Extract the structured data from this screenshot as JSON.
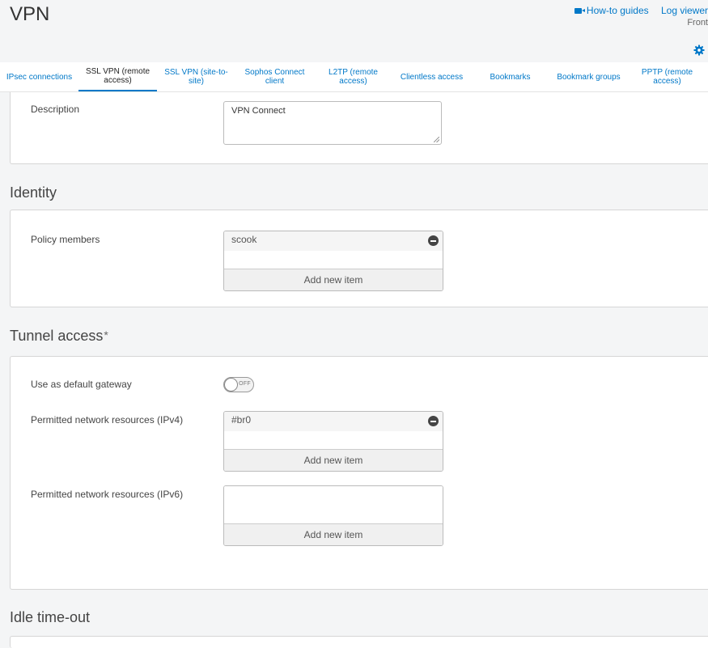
{
  "page": {
    "title": "VPN"
  },
  "header": {
    "howto_label": "How-to guides",
    "logviewer_label": "Log viewer",
    "sub_label": "Front"
  },
  "tabs": [
    {
      "label": "IPsec connections",
      "active": false
    },
    {
      "label": "SSL VPN (remote access)",
      "active": true
    },
    {
      "label": "SSL VPN (site-to-site)",
      "active": false
    },
    {
      "label": "Sophos Connect client",
      "active": false
    },
    {
      "label": "L2TP (remote access)",
      "active": false
    },
    {
      "label": "Clientless access",
      "active": false
    },
    {
      "label": "Bookmarks",
      "active": false
    },
    {
      "label": "Bookmark groups",
      "active": false
    },
    {
      "label": "PPTP (remote access)",
      "active": false
    }
  ],
  "general": {
    "description_label": "Description",
    "description_value": "VPN Connect"
  },
  "identity": {
    "title": "Identity",
    "policy_members_label": "Policy members",
    "policy_members": [
      "scook"
    ],
    "add_label": "Add new item"
  },
  "tunnel": {
    "title": "Tunnel access",
    "required_mark": "*",
    "default_gateway_label": "Use as default gateway",
    "default_gateway_state": "OFF",
    "ipv4_label": "Permitted network resources (IPv4)",
    "ipv4_items": [
      "#br0"
    ],
    "ipv6_label": "Permitted network resources (IPv6)",
    "ipv6_items": [],
    "add_label": "Add new item"
  },
  "idle": {
    "title": "Idle time-out"
  },
  "colors": {
    "accent": "#0078c8",
    "background": "#f4f5f6",
    "border": "#d6d6d6"
  }
}
